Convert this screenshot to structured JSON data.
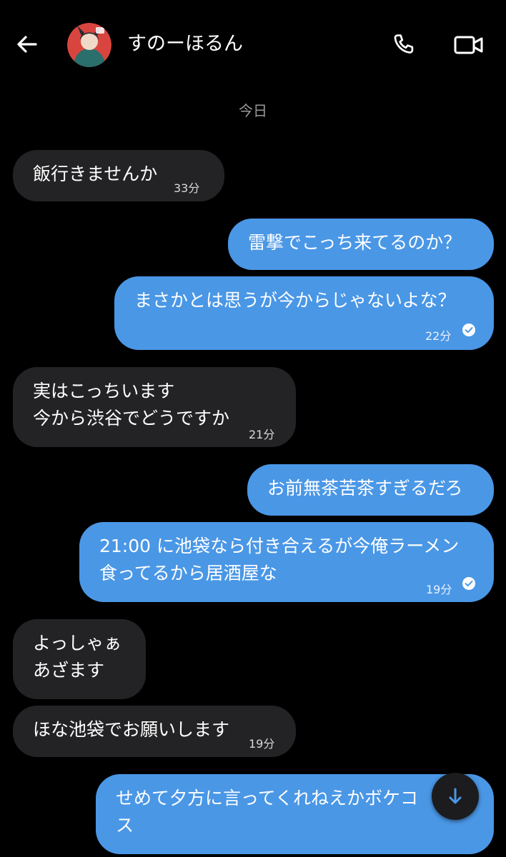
{
  "header": {
    "contact_name": "すのーほるん",
    "back_icon": "arrow-left-icon",
    "call_icon": "phone-icon",
    "video_icon": "video-camera-icon"
  },
  "date_separator": "今日",
  "messages": [
    {
      "direction": "in",
      "lines": [
        "飯行きませんか"
      ],
      "time": "33分"
    },
    {
      "direction": "out",
      "lines": [
        "雷撃でこっち来てるのか？"
      ]
    },
    {
      "direction": "out",
      "lines": [
        "まさかとは思うが今からじゃないよな？"
      ],
      "time": "22分",
      "read": true
    },
    {
      "direction": "in",
      "lines": [
        "実はこっちいます",
        "今から渋谷でどうですか"
      ],
      "time": "21分"
    },
    {
      "direction": "out",
      "lines": [
        "お前無茶苦茶すぎるだろ"
      ]
    },
    {
      "direction": "out",
      "lines": [
        "21:00 に池袋なら付き合えるが今俺ラーメン",
        "食ってるから居酒屋な"
      ],
      "time": "19分",
      "read": true
    },
    {
      "direction": "in",
      "lines": [
        "よっしゃぁ",
        "あざます"
      ]
    },
    {
      "direction": "in",
      "lines": [
        "ほな池袋でお願いします"
      ],
      "time": "19分"
    },
    {
      "direction": "out",
      "lines": [
        "せめて夕方に言ってくれねえかボケコ",
        "ス"
      ]
    }
  ],
  "colors": {
    "background": "#000000",
    "incoming_bubble": "#232325",
    "outgoing_bubble": "#4a97e6",
    "muted_text": "#9a9a9a"
  },
  "scroll_down_icon": "arrow-down-icon"
}
